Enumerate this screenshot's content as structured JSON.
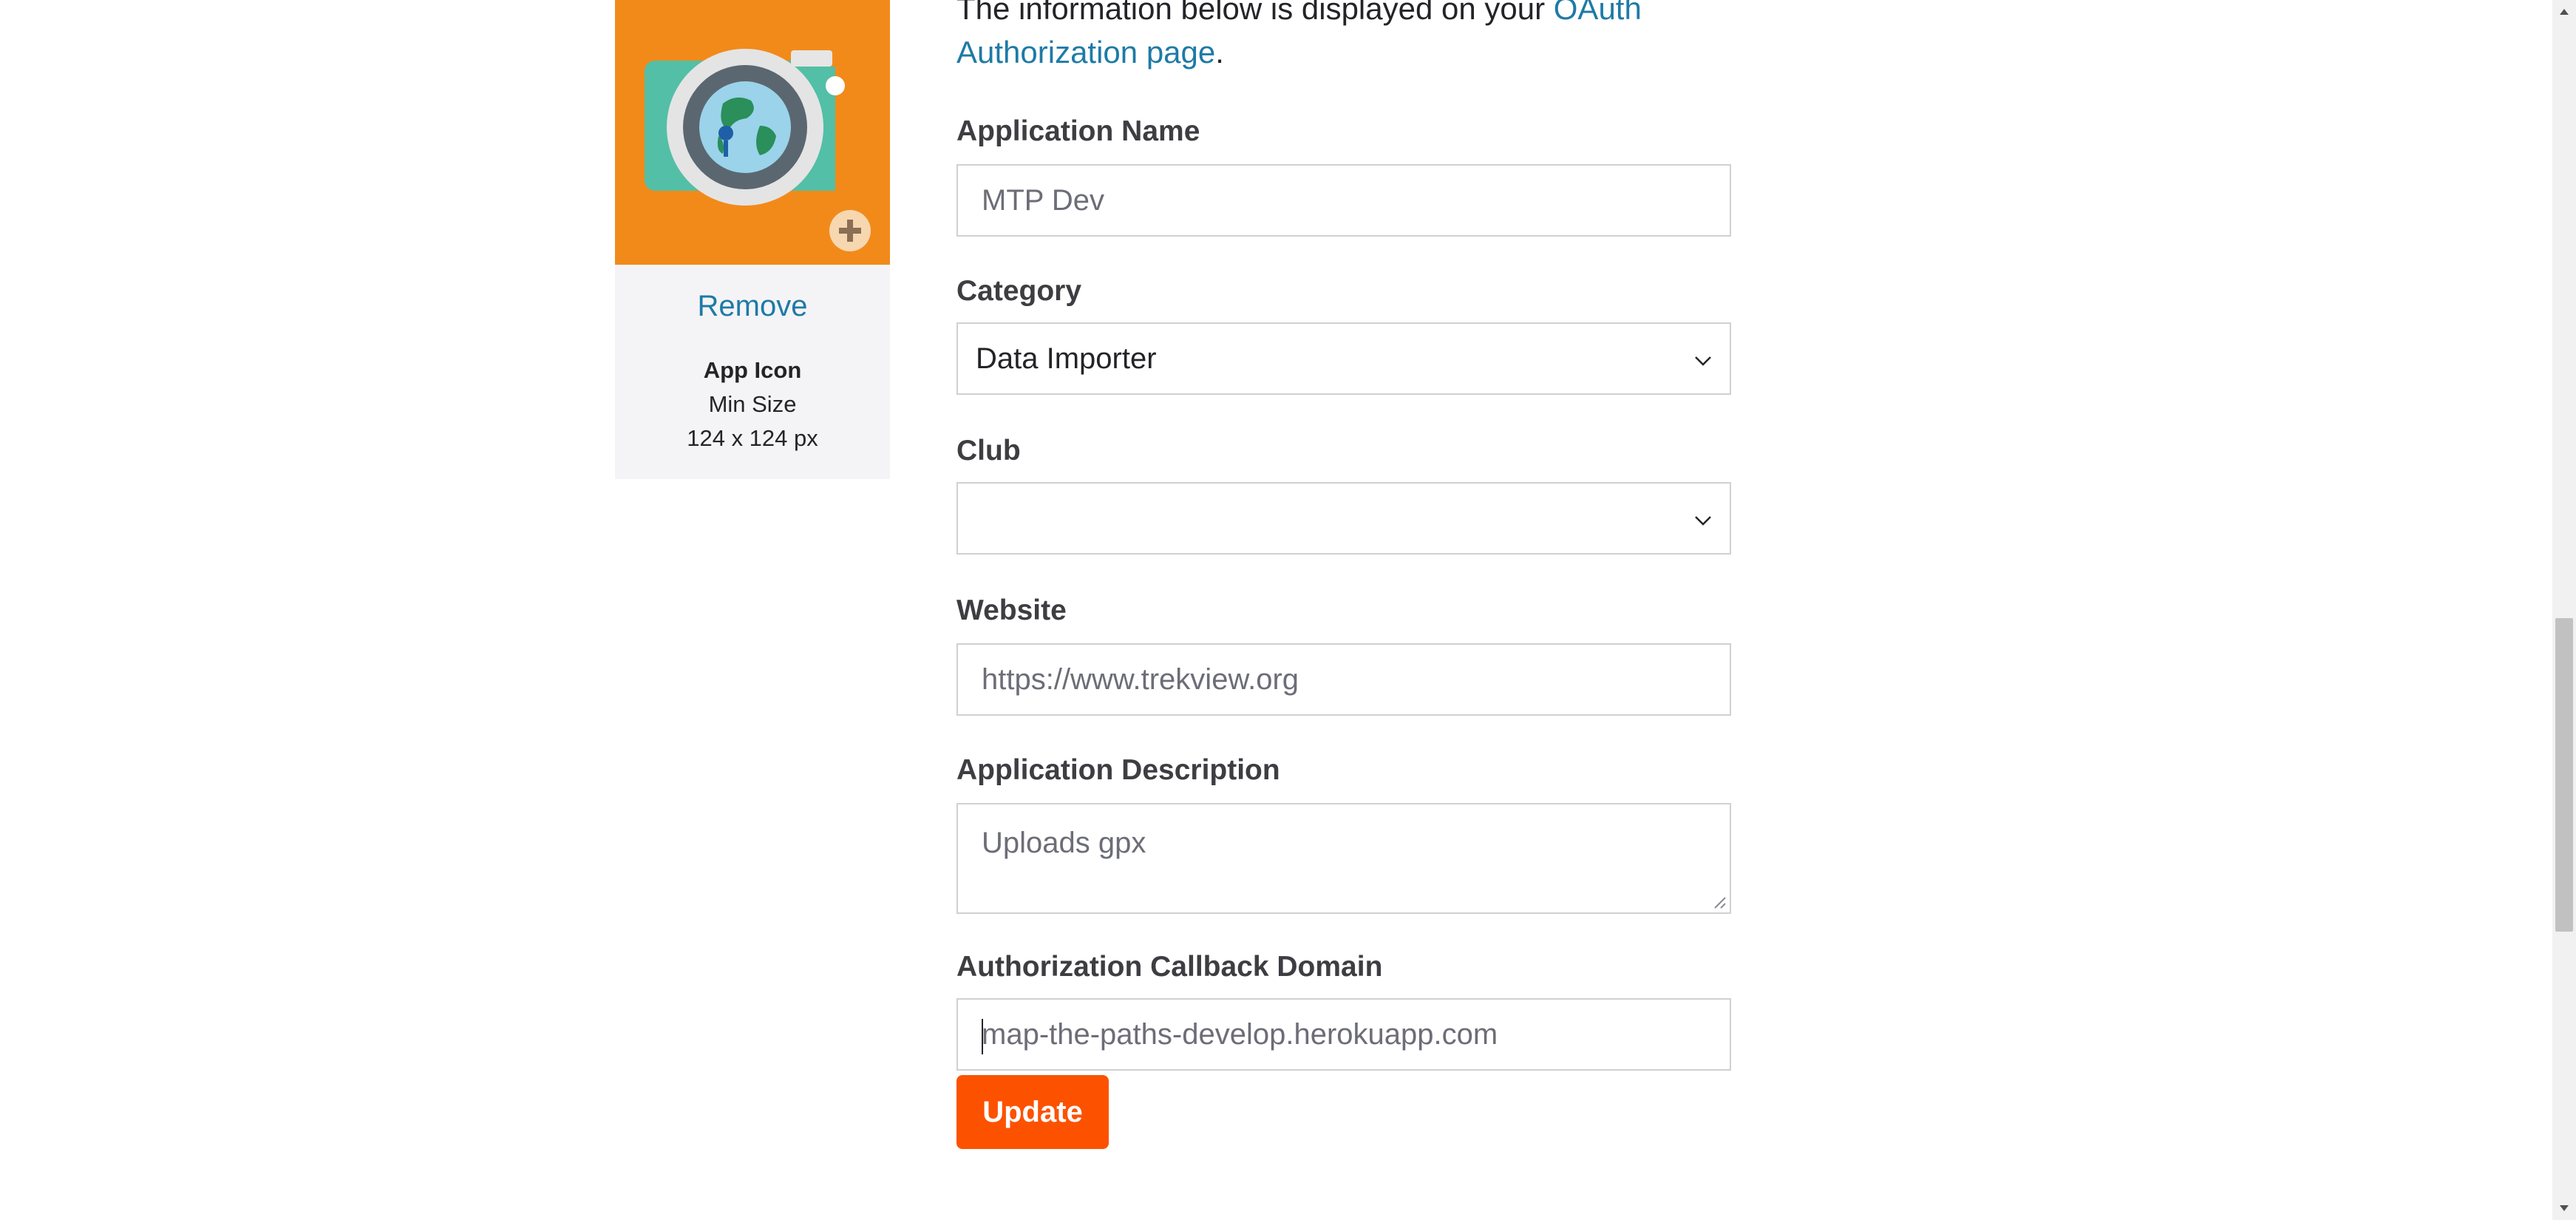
{
  "icon_panel": {
    "remove_label": "Remove",
    "title": "App Icon",
    "min_size_label": "Min Size",
    "min_size_value": "124 x 124 px"
  },
  "intro": {
    "text": "The information below is displayed on your ",
    "link": "OAuth Authorization page",
    "suffix": "."
  },
  "form": {
    "app_name": {
      "label": "Application Name",
      "value": "MTP Dev"
    },
    "category": {
      "label": "Category",
      "value": "Data Importer"
    },
    "club": {
      "label": "Club",
      "value": ""
    },
    "website": {
      "label": "Website",
      "value": "https://www.trekview.org"
    },
    "description": {
      "label": "Application Description",
      "value": "Uploads gpx"
    },
    "callback": {
      "label": "Authorization Callback Domain",
      "value": "map-the-paths-develop.herokuapp.com"
    },
    "update_label": "Update"
  },
  "colors": {
    "accent": "#fc5200",
    "link": "#1e7aa6",
    "icon_bg": "#f28a1a"
  },
  "icons": {
    "app_icon": "camera-globe-icon",
    "add": "plus-circle-icon",
    "dropdown": "chevron-down-icon",
    "resize": "resize-handle-icon"
  }
}
